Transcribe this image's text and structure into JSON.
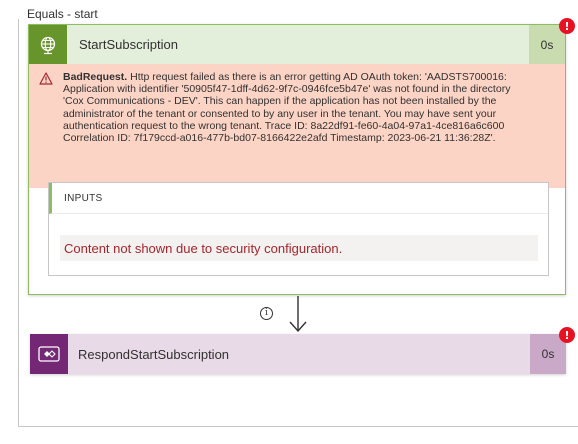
{
  "scope": {
    "title": "Equals - start"
  },
  "action1": {
    "title": "StartSubscription",
    "duration": "0s",
    "status_badge": "!",
    "icon": "globe-icon",
    "error": {
      "code": "BadRequest.",
      "message": " Http request failed as there is an error getting AD OAuth token: 'AADSTS700016:\nApplication with identifier '50905f47-1dff-4d62-9f7c-0946fce5b47e' was not found in the directory\n'Cox Communications - DEV'. This can happen if the application has not been installed by the\nadministrator of the tenant or consented to by any user in the tenant. You may have sent your\nauthentication request to the wrong tenant. Trace ID: 8a22df91-fe60-4a04-97a1-4ce816a6c600\nCorrelation ID: 7f179ccd-a016-477b-bd07-8166422e2afd Timestamp: 2023-06-21 11:36:28Z'."
    },
    "inputs": {
      "label": "INPUTS",
      "message": "Content not shown due to security configuration."
    }
  },
  "connector": {
    "info_icon": "i"
  },
  "action2": {
    "title": "RespondStartSubscription",
    "duration": "0s",
    "status_badge": "!",
    "icon": "power-apps-response-icon"
  },
  "colors": {
    "action1_accent": "#68952b",
    "action2_accent": "#742774",
    "error_band": "#fcd4c6",
    "error_text": "#a4262c",
    "status_badge": "#e81123"
  }
}
